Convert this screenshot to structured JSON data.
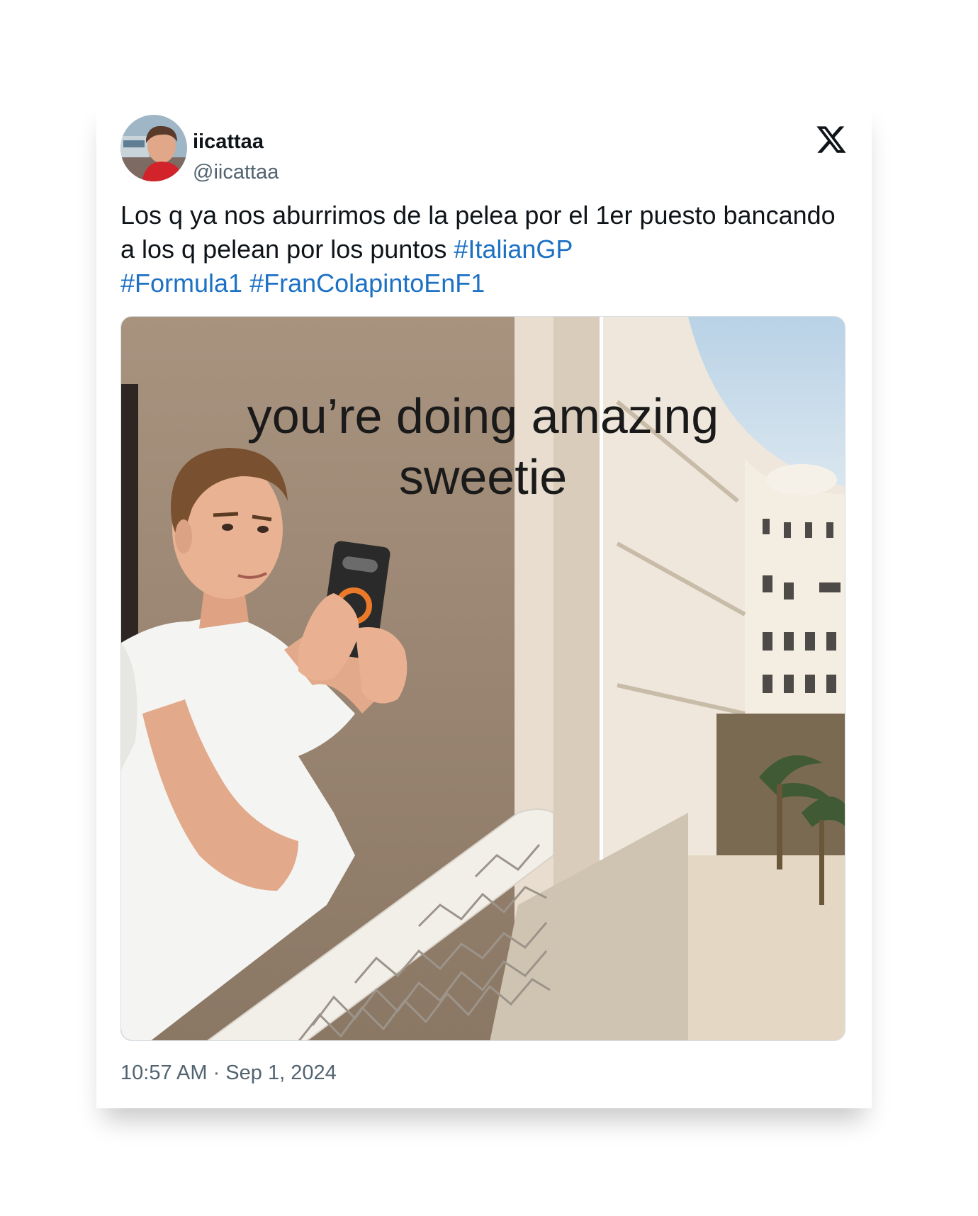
{
  "user": {
    "display_name": "iicattaa",
    "handle": "@iicattaa"
  },
  "logo_icon": "x-logo-icon",
  "tweet": {
    "text_before": "Los q ya nos aburrimos de la pelea por el 1er puesto bancando a los q pelean por los puntos ",
    "hashtags": [
      "#ItalianGP",
      "#Formula1",
      "#FranColapintoEnF1"
    ]
  },
  "meme": {
    "caption_line1": "you’re doing amazing",
    "caption_line2": "sweetie"
  },
  "timestamp": "10:57 AM · Sep 1, 2024",
  "colors": {
    "hashtag": "#1d71c4",
    "text": "#0f1419",
    "secondary": "#536471"
  }
}
